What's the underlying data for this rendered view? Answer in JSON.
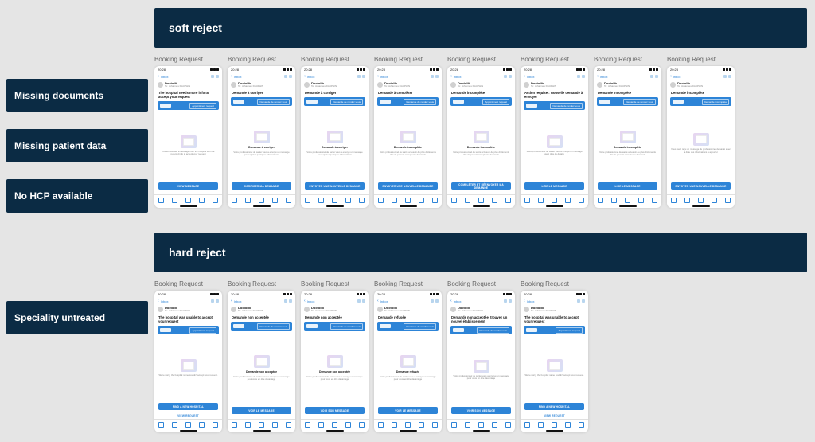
{
  "sections": {
    "soft": {
      "label": "soft reject"
    },
    "hard": {
      "label": "hard reject"
    }
  },
  "left_labels": {
    "missing_docs": "Missing documents",
    "missing_patient": "Missing patient data",
    "no_hcp": "No HCP available",
    "speciality": "Speciality untreated"
  },
  "common": {
    "card_title": "Booking Request",
    "time": "20:28",
    "inbox": "Inbox",
    "sender": "Doctolib",
    "sender_sub": "To: Johannes DAUPHIN"
  },
  "soft_cards": [
    {
      "title": "The hospital needs more info to accept your request",
      "tag": "Appointment request",
      "heading": "",
      "text": "You've received a message from the hospital with the required info to accept your request",
      "btn1": "VIEW MESSAGE",
      "btn2": ""
    },
    {
      "title": "Demande à corriger",
      "tag": "Demande de rendez-vous",
      "heading": "Demande à corriger",
      "text": "Votre professionnel de santé vous a envoyé un message pour ajuster quelques informations",
      "btn1": "CORRIGER MA DEMANDE",
      "btn2": ""
    },
    {
      "title": "Demande à corriger",
      "tag": "Demande de rendez-vous",
      "heading": "Demande à corriger",
      "text": "Votre professionnel de santé vous a envoyé un message pour ajuster quelques informations",
      "btn1": "ENVOYER UNE NOUVELLE DEMANDE",
      "btn2": ""
    },
    {
      "title": "Demande à compléter",
      "tag": "Demande de rendez-vous",
      "heading": "Demande incomplète",
      "text": "Votre professionnel de santé a besoin de plus d'éléments afin de pouvoir accepter la demande",
      "btn1": "ENVOYER UNE NOUVELLE DEMANDE",
      "btn2": ""
    },
    {
      "title": "Demande incomplète",
      "tag": "Appointment request",
      "heading": "Demande incomplète",
      "text": "Votre professionnel de santé a besoin de plus d'éléments afin de pouvoir accepter la demande",
      "btn1": "COMPLÉTER ET RÉENVOYER MA DEMANDE",
      "btn2": ""
    },
    {
      "title": "Action requise : Nouvelle demande à envoyer",
      "tag": "Demande de rendez-vous",
      "heading": "",
      "text": "Votre professionnel de santé vous a envoyé un message avec plus de détails",
      "btn1": "LIRE LE MESSAGE",
      "btn2": ""
    },
    {
      "title": "Demande incomplète",
      "tag": "Demande de rendez-vous",
      "heading": "Demande incomplète",
      "text": "Votre professionnel de santé a besoin de plus d'éléments afin de pouvoir accepter la demande",
      "btn1": "LIRE LE MESSAGE",
      "btn2": ""
    },
    {
      "title": "Demande incomplète",
      "tag": "Demande incomplète",
      "heading": "",
      "text": "Vous avez reçu un message du professionnel de santé avec la liste des informations à apporter",
      "btn1": "ENVOYER UNE NOUVELLE DEMANDE",
      "btn2": ""
    }
  ],
  "hard_cards": [
    {
      "title": "The hospital was unable to accept your request",
      "tag": "Appointment request",
      "heading": "",
      "text": "We're sorry, the hospital name couldn't accept your request.",
      "btn1": "FIND A NEW HOSPITAL",
      "btn2": "VIEW REQUEST"
    },
    {
      "title": "Demande non acceptée",
      "tag": "Demande de rendez-vous",
      "heading": "Demande non acceptée",
      "text": "Votre professionnel de santé vous a envoyé un message pour vous en dire davantage",
      "btn1": "VOIR LE MESSAGE",
      "btn2": ""
    },
    {
      "title": "Demande non acceptée",
      "tag": "Demande de rendez-vous",
      "heading": "Demande non acceptée",
      "text": "Votre professionnel de santé vous a envoyé un message pour vous en dire davantage",
      "btn1": "VOIR SON MESSAGE",
      "btn2": ""
    },
    {
      "title": "Demande refusée",
      "tag": "Demande de rendez-vous",
      "heading": "Demande refusée",
      "text": "Votre professionnel de santé vous a envoyé un message pour vous en dire davantage",
      "btn1": "VOIR LE MESSAGE",
      "btn2": ""
    },
    {
      "title": "Demande non acceptée, trouvez un nouvel établissement",
      "tag": "Demande de rendez-vous",
      "heading": "",
      "text": "Votre professionnel de santé vous a envoyé un message pour vous en dire davantage",
      "btn1": "VOIR SON MESSAGE",
      "btn2": ""
    },
    {
      "title": "The hospital was unable to accept your request",
      "tag": "Appointment request",
      "heading": "",
      "text": "We're sorry, the hospital name couldn't accept your request.",
      "btn1": "FIND A NEW HOSPITAL",
      "btn2": "VIEW REQUEST"
    }
  ]
}
